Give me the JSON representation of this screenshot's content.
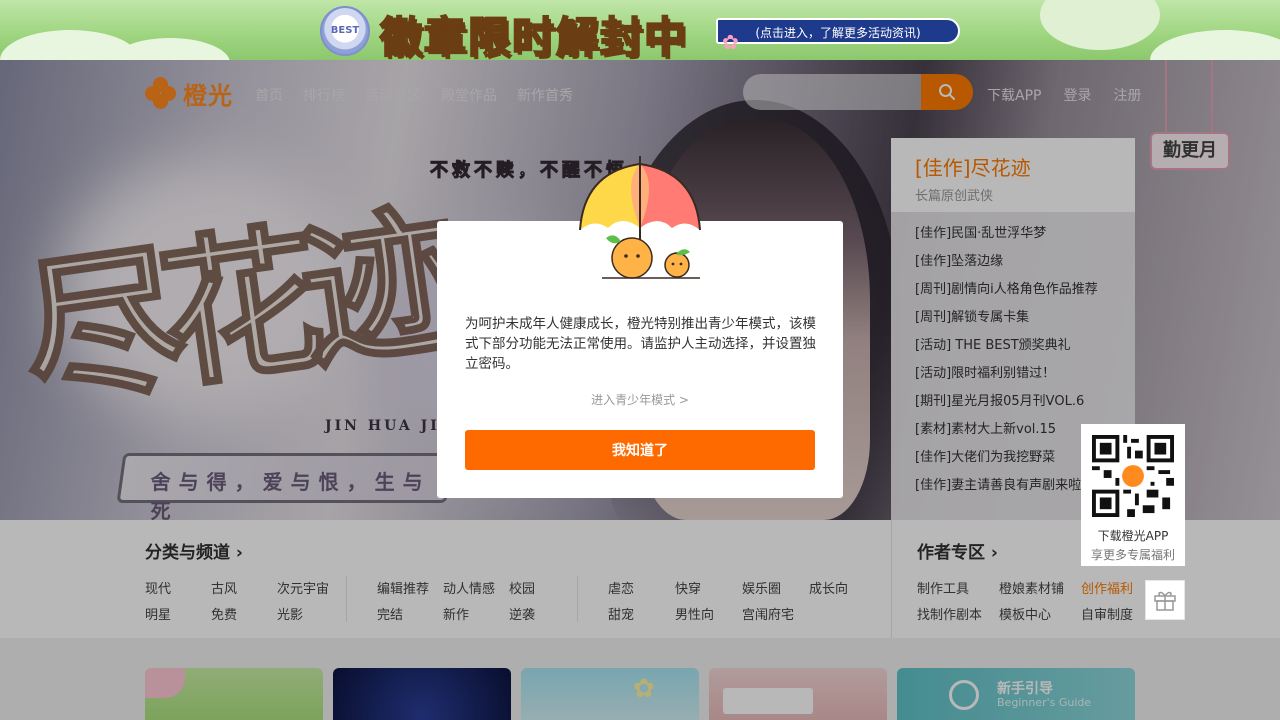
{
  "top_banner": {
    "emblem_text": "BEST",
    "title": "徽章限时解封中",
    "pill": "(点击进入，了解更多活动资讯)"
  },
  "header": {
    "logo_text": "橙光",
    "nav": [
      "首页",
      "排行榜",
      "活动专区",
      "殿堂作品",
      "新作首秀"
    ],
    "search_placeholder": "",
    "download_app": "下载APP",
    "login": "登录",
    "register": "注册"
  },
  "hanging_badge": "勤更月",
  "hero": {
    "calligraphy": "尽花迹",
    "latin": "JIN HUA JI",
    "motto_top": "不救不赎，不醒不悟",
    "motto_strip": "舍与得，爱与恨，生与死"
  },
  "featured": {
    "title": "[佳作]尽花迹",
    "subtitle": "长篇原创武侠",
    "items": [
      "[佳作]民国·乱世浮华梦",
      "[佳作]坠落边缘",
      "[周刊]剧情向i人格角色作品推荐",
      "[周刊]解锁专属卡集",
      "[活动] THE BEST颁奖典礼",
      "[活动]限时福利别错过！",
      "[期刊]星光月报05月刊VOL.6",
      "[素材]素材大上新vol.15",
      "[佳作]大佬们为我挖野菜",
      "[佳作]妻主请善良有声剧来啦"
    ]
  },
  "categories": {
    "title": "分类与频道",
    "group1": [
      "现代",
      "古风",
      "次元宇宙",
      "明星",
      "免费",
      "光影"
    ],
    "group2": [
      "编辑推荐",
      "动人情感",
      "校园",
      "完结",
      "新作",
      "逆袭"
    ],
    "group3": [
      "虐恋",
      "快穿",
      "娱乐圈",
      "成长向",
      "甜宠",
      "男性向",
      "宫闱府宅"
    ]
  },
  "author_zone": {
    "title": "作者专区",
    "links": [
      "制作工具",
      "橙娘素材铺",
      "创作福利",
      "找制作剧本",
      "模板中心",
      "自审制度"
    ]
  },
  "qr": {
    "line1": "下载橙光APP",
    "line2": "享更多专属福利"
  },
  "guide_card": {
    "title": "新手引导",
    "subtitle": "Beginner's Guide"
  },
  "modal": {
    "text": "为呵护未成年人健康成长，橙光特别推出青少年模式，该模式下部分功能无法正常使用。请监护人主动选择，并设置独立密码。",
    "enter_youth_mode": "进入青少年模式 >",
    "confirm": "我知道了"
  },
  "colors": {
    "accent": "#ff6a00",
    "featured_title": "#ff7a00"
  }
}
